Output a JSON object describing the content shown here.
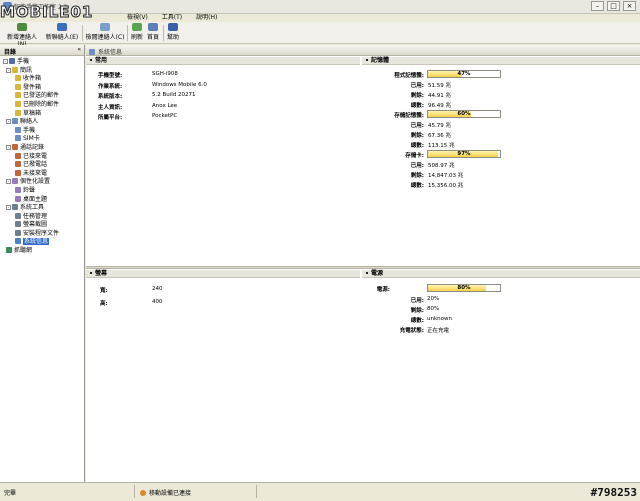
{
  "app": {
    "title": "智能手機工作室 2.3",
    "logo": "MOBILE01",
    "window_controls": [
      "–",
      "□",
      "×"
    ]
  },
  "menu": [
    "檢視(V)",
    "工具(T)",
    "說明(H)"
  ],
  "toolbar": [
    {
      "label": "新增連絡人(N)",
      "icon": "new-contact-icon",
      "color": "#4c8a3e"
    },
    {
      "label": "新聯絡人(E)",
      "icon": "contact-icon",
      "color": "#3a6fbf"
    },
    {
      "label": "檢閱連絡人(C)",
      "icon": "view-contacts-icon",
      "color": "#7a9fcf"
    },
    {
      "label": "刷新",
      "icon": "refresh-icon",
      "color": "#59a34f"
    },
    {
      "label": "首頁",
      "icon": "home-icon",
      "color": "#5b7db8"
    },
    {
      "label": "幫助",
      "icon": "help-icon",
      "color": "#3b5fa8"
    }
  ],
  "sidebar": {
    "header": "目錄",
    "collapse": "«",
    "tree": [
      {
        "label": "手機",
        "level": 0,
        "expander": "-",
        "icon": "phone-icon",
        "color": "#4e6fa8"
      },
      {
        "label": "簡訊",
        "level": 1,
        "expander": "-",
        "icon": "sms-folder-icon",
        "color": "#d9b53a"
      },
      {
        "label": "收件箱",
        "level": 2,
        "icon": "inbox-icon",
        "color": "#d9b53a"
      },
      {
        "label": "發件箱",
        "level": 2,
        "icon": "outbox-icon",
        "color": "#d9b53a"
      },
      {
        "label": "已發送的郵件",
        "level": 2,
        "icon": "sent-icon",
        "color": "#d9b53a"
      },
      {
        "label": "已刪除的郵件",
        "level": 2,
        "icon": "deleted-icon",
        "color": "#d9b53a"
      },
      {
        "label": "草稿箱",
        "level": 2,
        "icon": "drafts-icon",
        "color": "#d9b53a"
      },
      {
        "label": "聯絡人",
        "level": 1,
        "expander": "-",
        "icon": "contacts-icon",
        "color": "#6a8fc4"
      },
      {
        "label": "手機",
        "level": 2,
        "icon": "phone-contacts-icon",
        "color": "#6a8fc4"
      },
      {
        "label": "SIM卡",
        "level": 2,
        "icon": "sim-card-icon",
        "color": "#6a8fc4"
      },
      {
        "label": "通話記錄",
        "level": 1,
        "expander": "-",
        "icon": "call-log-icon",
        "color": "#c2653b"
      },
      {
        "label": "已接來電",
        "level": 2,
        "icon": "received-call-icon",
        "color": "#c2653b"
      },
      {
        "label": "已撥電話",
        "level": 2,
        "icon": "dialed-call-icon",
        "color": "#c2653b"
      },
      {
        "label": "未接來電",
        "level": 2,
        "icon": "missed-call-icon",
        "color": "#c2653b"
      },
      {
        "label": "個性化設置",
        "level": 1,
        "expander": "-",
        "icon": "personalize-icon",
        "color": "#9a7bc0"
      },
      {
        "label": "鈴聲",
        "level": 2,
        "icon": "ringtone-icon",
        "color": "#9a7bc0"
      },
      {
        "label": "桌面主題",
        "level": 2,
        "icon": "theme-icon",
        "color": "#9a7bc0"
      },
      {
        "label": "系統工具",
        "level": 1,
        "expander": "-",
        "icon": "system-tools-icon",
        "color": "#6f7f8e"
      },
      {
        "label": "任務管理",
        "level": 2,
        "icon": "task-manager-icon",
        "color": "#6f7f8e"
      },
      {
        "label": "螢幕截圖",
        "level": 2,
        "icon": "screenshot-icon",
        "color": "#6f7f8e"
      },
      {
        "label": "安裝程序文件",
        "level": 2,
        "icon": "installer-icon",
        "color": "#6f7f8e"
      },
      {
        "label": "系統信息",
        "level": 2,
        "icon": "system-info-icon",
        "color": "#4e7fc7",
        "selected": true
      },
      {
        "label": "抓聽網",
        "level": 1,
        "icon": "web-icon",
        "color": "#3a8a5a"
      }
    ]
  },
  "main": {
    "header": "系統信息",
    "general": {
      "title": "常用",
      "fields": [
        {
          "label": "手機型號:",
          "value": "SGH-i908"
        },
        {
          "label": "作業系統:",
          "value": "Windows Mobile 6.0"
        },
        {
          "label": "系統版本:",
          "value": "5.2 Build 20271"
        },
        {
          "label": "主人資訊:",
          "value": "Anox Lee"
        },
        {
          "label": "所屬平台:",
          "value": "PocketPC"
        }
      ]
    },
    "memory": {
      "title": "記憶體",
      "groups": [
        {
          "label": "程式記憶體:",
          "percent": 47,
          "percent_text": "47%",
          "rows": [
            {
              "label": "已用:",
              "value": "51.59 兆"
            },
            {
              "label": "剩餘:",
              "value": "44.91 兆"
            },
            {
              "label": "總數:",
              "value": "96.49 兆"
            }
          ]
        },
        {
          "label": "存儲記憶體:",
          "percent": 60,
          "percent_text": "60%",
          "rows": [
            {
              "label": "已用:",
              "value": "45.79 兆"
            },
            {
              "label": "剩餘:",
              "value": "67.36 兆"
            },
            {
              "label": "總數:",
              "value": "113.15 兆"
            }
          ]
        },
        {
          "label": "存儲卡:",
          "percent": 97,
          "percent_text": "97%",
          "rows": [
            {
              "label": "已用:",
              "value": "508.97 兆"
            },
            {
              "label": "剩餘:",
              "value": "14,847.03 兆"
            },
            {
              "label": "總數:",
              "value": "15,356.00 兆"
            }
          ]
        }
      ]
    },
    "screen": {
      "title": "螢幕",
      "fields": [
        {
          "label": "寬:",
          "value": "240"
        },
        {
          "label": "高:",
          "value": "400"
        }
      ]
    },
    "power": {
      "title": "電源",
      "label": "電源:",
      "percent": 80,
      "percent_text": "80%",
      "rows": [
        {
          "label": "已用:",
          "value": "20%"
        },
        {
          "label": "剩餘:",
          "value": "80%"
        },
        {
          "label": "總數:",
          "value": "unknown"
        },
        {
          "label": "充電狀態:",
          "value": "正在充電"
        }
      ]
    }
  },
  "status": {
    "left": "完畢",
    "connection": "移動設備已連接"
  },
  "watermark": "#798253"
}
